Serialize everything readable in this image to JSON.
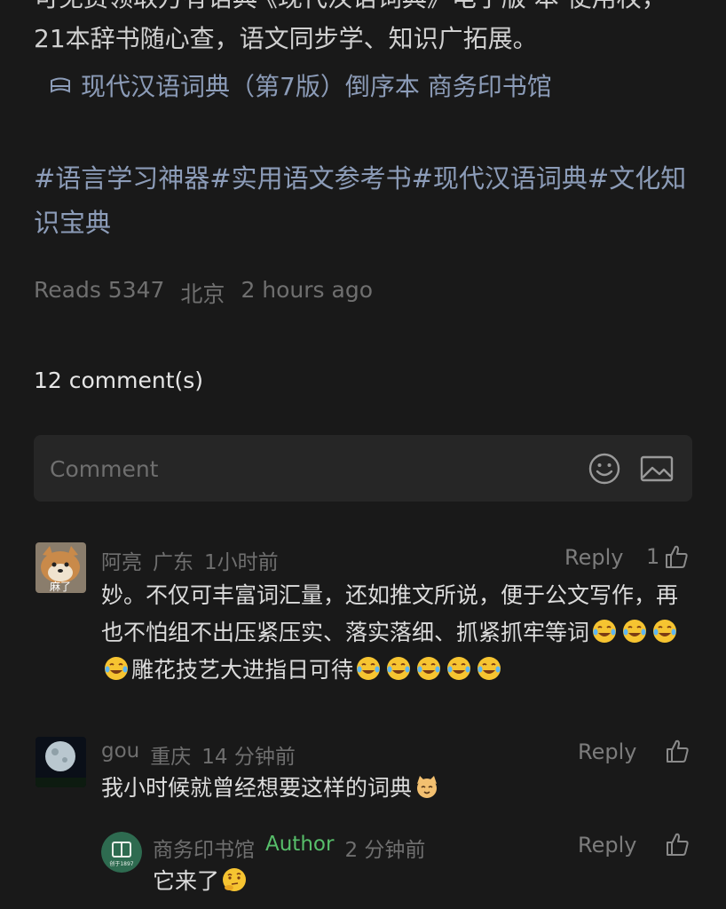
{
  "post": {
    "partial_line": "可免费领取万有语典·《现代汉语词典》电子版 本 使用权，",
    "line2": "21本辞书随心查，语文同步学、知识广拓展。",
    "book_link": "现代汉语词典（第7版）倒序本 商务印书馆",
    "tags": "#语言学习神器#实用语文参考书#现代汉语词典#文化知识宝典",
    "reads": "Reads 5347",
    "location": "北京",
    "time": "2 hours ago"
  },
  "comments_section": {
    "count_label": "12 comment(s)",
    "input_placeholder": "Comment",
    "emoji_icon": "smiley-icon",
    "image_icon": "image-icon"
  },
  "comments": [
    {
      "user": "阿亮",
      "location": "广东",
      "time": "1小时前",
      "avatar_label": "麻了",
      "reply_label": "Reply",
      "likes": "1",
      "text_part1": "妙。不仅可丰富词汇量，还如推文所说，便于公文写作，再也不怕组不出压紧压实、落实落细、抓紧抓牢等词",
      "text_part2": "雕花技艺大进指日可待"
    },
    {
      "user": "gou",
      "location": "重庆",
      "time": "14 分钟前",
      "reply_label": "Reply",
      "text": "我小时候就曾经想要这样的词典",
      "replies": [
        {
          "user": "商务印书馆",
          "author_badge": "Author",
          "time": "2 分钟前",
          "avatar_label": "创于1897",
          "reply_label": "Reply",
          "text": "它来了"
        }
      ]
    }
  ],
  "colors": {
    "background": "#191919",
    "link": "#8c9cb8",
    "author": "#57be6a"
  }
}
